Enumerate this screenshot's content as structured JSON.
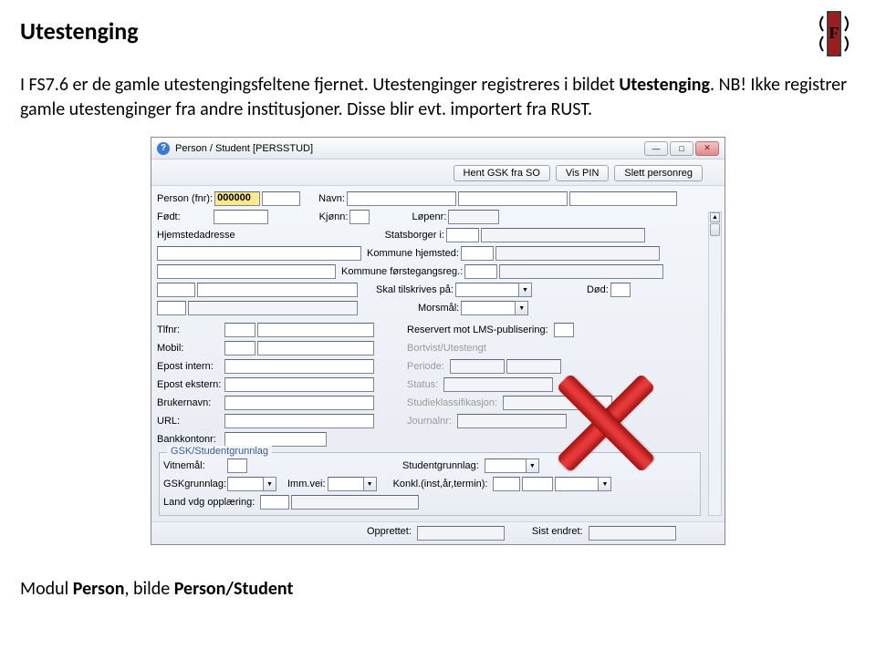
{
  "page": {
    "title": "Utestenging",
    "p1a": "I FS7.6 er de gamle utestengingsfeltene fjernet. Utestenginger registreres i bildet ",
    "p1b": "Utestenging",
    "p1c": ". NB! Ikke registrer gamle utestenginger fra andre institusjoner. Disse blir evt. importert fra RUST.",
    "caption_a": "Modul ",
    "caption_b": "Person",
    "caption_c": ", bilde ",
    "caption_d": "Person/Student"
  },
  "win": {
    "title": "Person / Student  [PERSSTUD]",
    "btn_gsk": "Hent GSK fra SO",
    "btn_pin": "Vis PIN",
    "btn_slett": "Slett personreg"
  },
  "form": {
    "person_fnr": "Person (fnr):",
    "fnr_val": "000000",
    "navn": "Navn:",
    "fodt": "Født:",
    "kjonn": "Kjønn:",
    "lopenr": "Løpenr:",
    "hjemadr": "Hjemstedadresse",
    "statsborger": "Statsborger i:",
    "komm_hjem": "Kommune hjemsted:",
    "komm_forst": "Kommune førstegangsreg.:",
    "skal_tilskr": "Skal tilskrives på:",
    "dod": "Død:",
    "morsmal": "Morsmål:",
    "tlf": "Tlfnr:",
    "mobil": "Mobil:",
    "epost_int": "Epost intern:",
    "epost_eks": "Epost ekstern:",
    "bruker": "Brukernavn:",
    "url": "URL:",
    "bank": "Bankkontonr:",
    "reservert": "Reservert mot LMS-publisering:",
    "bortvist": "Bortvist/Utestengt",
    "periode": "Periode:",
    "status": "Status:",
    "studkl": "Studieklassifikasjon:",
    "journal": "Journalnr:"
  },
  "grp": {
    "legend": "GSK/Studentgrunnlag",
    "vitnemal": "Vitnemål:",
    "gskgrunn": "GSKgrunnlag:",
    "immvei": "Imm.vei:",
    "studgrunn": "Studentgrunnlag:",
    "konkl": "Konkl.(inst,år,termin):",
    "landvdg": "Land vdg opplæring:"
  },
  "footer": {
    "opprettet": "Opprettet:",
    "sist": "Sist endret:"
  }
}
